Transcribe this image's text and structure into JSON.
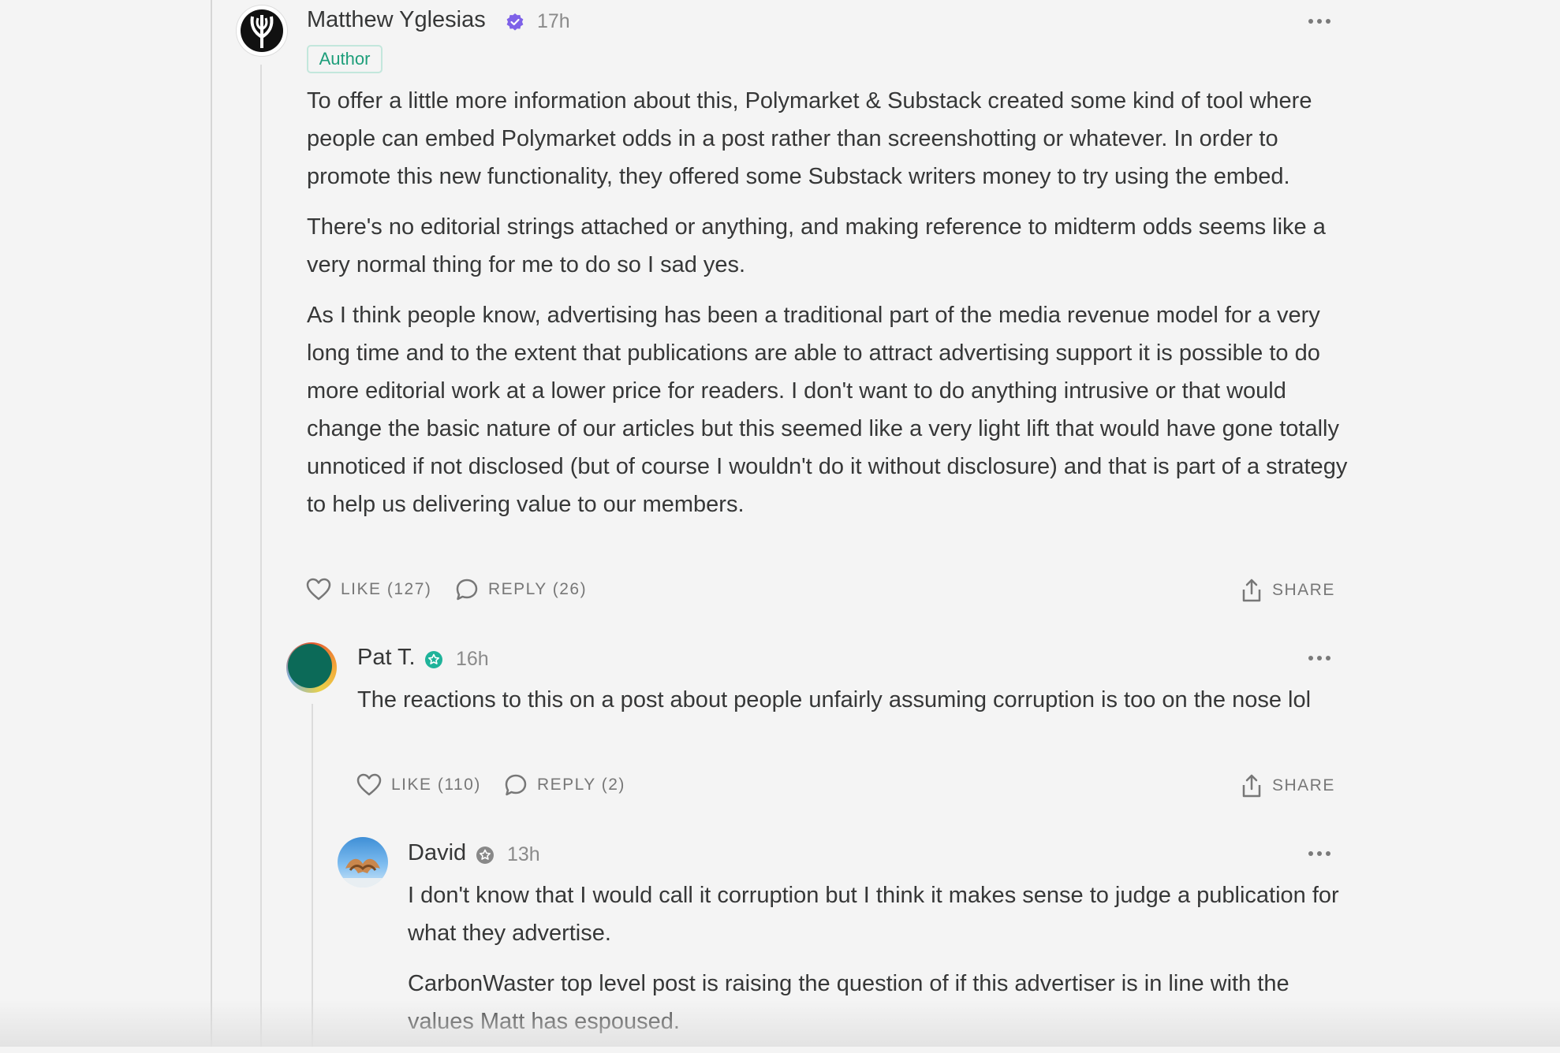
{
  "comments": [
    {
      "author": "Matthew Yglesias",
      "time": "17h",
      "tag": "Author",
      "paragraphs": [
        "To offer a little more information about this, Polymarket & Substack created some kind of tool where people can embed Polymarket odds in a post rather than screenshotting or whatever. In order to promote this new functionality, they offered some Substack writers money to try using the embed.",
        "There's no editorial strings attached or anything, and making reference to midterm odds seems like a very normal thing for me to do so I sad yes.",
        "As I think people know, advertising has been a traditional part of the media revenue model for a very long time and to the extent that publications are able to attract advertising support it is possible to do more editorial work at a lower price for readers. I don't want to do anything intrusive or that would change the basic nature of our articles but this seemed like a very light lift that would have gone totally unnoticed if not disclosed (but of course I wouldn't do it without disclosure) and that is part of a strategy to help us delivering value to our members."
      ],
      "like_label": "LIKE (127)",
      "reply_label": "REPLY (26)",
      "share_label": "SHARE"
    },
    {
      "author": "Pat T.",
      "time": "16h",
      "paragraphs": [
        "The reactions to this on a post about people unfairly assuming corruption is too on the nose lol"
      ],
      "like_label": "LIKE (110)",
      "reply_label": "REPLY (2)",
      "share_label": "SHARE"
    },
    {
      "author": "David",
      "time": "13h",
      "paragraphs": [
        "I don't know that I would call it corruption but I think it makes sense to judge a publication for what they advertise.",
        "CarbonWaster top level post is raising the question of if this advertiser is in line with the values Matt has espoused."
      ]
    }
  ],
  "icons": {
    "verified": "verified-check-icon",
    "subscriber_teal": "subscriber-badge-icon",
    "subscriber_gray": "subscriber-badge-icon",
    "more": "more-dots-icon",
    "like": "heart-icon",
    "reply": "speech-bubble-icon",
    "share": "share-icon"
  },
  "colors": {
    "verified": "#7e61e8",
    "subscriber_teal": "#1fb39a",
    "subscriber_gray": "#888888",
    "author_tag": "#1d9e7a"
  }
}
